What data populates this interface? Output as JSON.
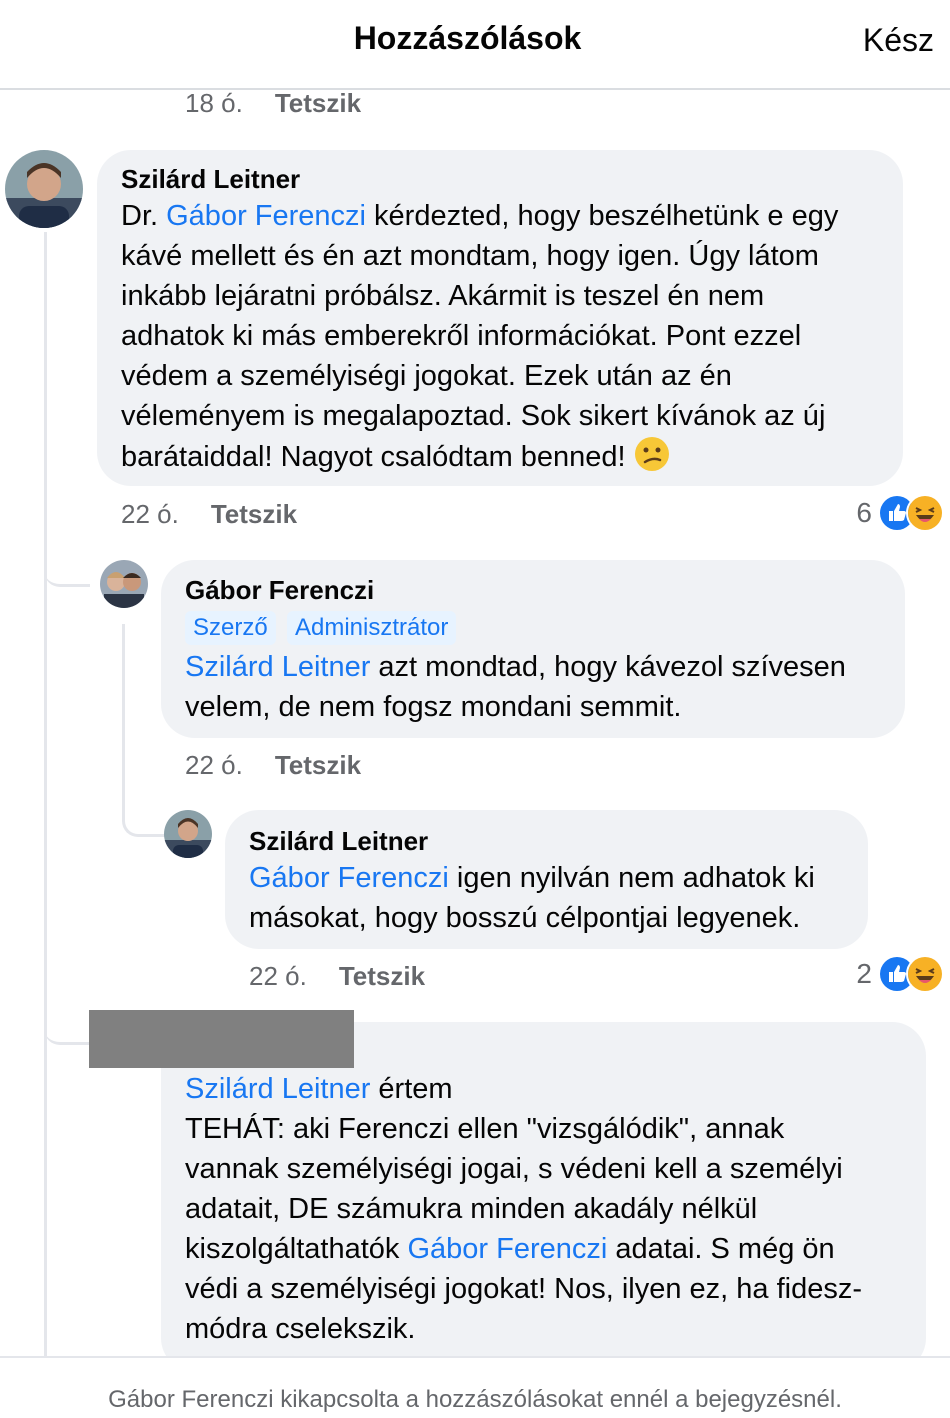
{
  "header": {
    "title": "Hozzászólások",
    "done_label": "Kész"
  },
  "top_meta": {
    "time": "18 ó.",
    "like_label": "Tetszik"
  },
  "comments": [
    {
      "author": "Szilárd Leitner",
      "mention": "Gábor Ferenczi",
      "lines": [
        "Dr. ",
        " kérdezted, hogy beszélhetünk e egy",
        "kávé mellett és én azt mondtam, hogy igen. Úgy látom",
        "inkább lejáratni próbálsz. Akármit is teszel én nem",
        "adhatok ki más emberekről információkat. Pont ezzel",
        "védem a személyiségi jogokat. Ezek után az én",
        "véleményem is megalapoztad. Sok sikert kívánok az új",
        "barátaiddal! Nagyot csalódtam benned!"
      ],
      "emoji": "confused-face",
      "time": "22 ó.",
      "like_label": "Tetszik",
      "reaction_count": "6"
    },
    {
      "author": "Gábor Ferenczi",
      "badges": [
        "Szerző",
        "Adminisztrátor"
      ],
      "mention": "Szilárd Leitner",
      "lines": [
        " azt mondtad, hogy kávezol szívesen",
        "velem, de nem fogsz mondani semmit."
      ],
      "time": "22 ó.",
      "like_label": "Tetszik"
    },
    {
      "author": "Szilárd Leitner",
      "mention": "Gábor Ferenczi",
      "lines": [
        " igen nyilván nem adhatok ki",
        "másokat, hogy bosszú célpontjai legyenek."
      ],
      "time": "22 ó.",
      "like_label": "Tetszik",
      "reaction_count": "2"
    },
    {
      "mention": "Szilárd Leitner",
      "mention2": "Gábor Ferenczi",
      "lines": [
        " értem",
        " TEHÁT: aki Ferenczi ellen \"vizsgálódik\", annak",
        "vannak személyiségi jogai, s védeni kell a személyi",
        "adatait, DE számukra minden akadály nélkül",
        "kiszolgáltathatók ",
        "  adatai. S még ön",
        "védi a személyiségi jogokat! Nos, ilyen ez, ha fidesz-",
        "módra cselekszik."
      ]
    }
  ],
  "footer": {
    "notice": "Gábor Ferenczi kikapcsolta a hozzászólásokat ennél a bejegyzésnél."
  },
  "colors": {
    "mention": "#1877f2",
    "bubble": "#f0f2f5",
    "meta": "#65676b",
    "like_reaction": "#1877f2",
    "haha_reaction": "#f7b125"
  }
}
